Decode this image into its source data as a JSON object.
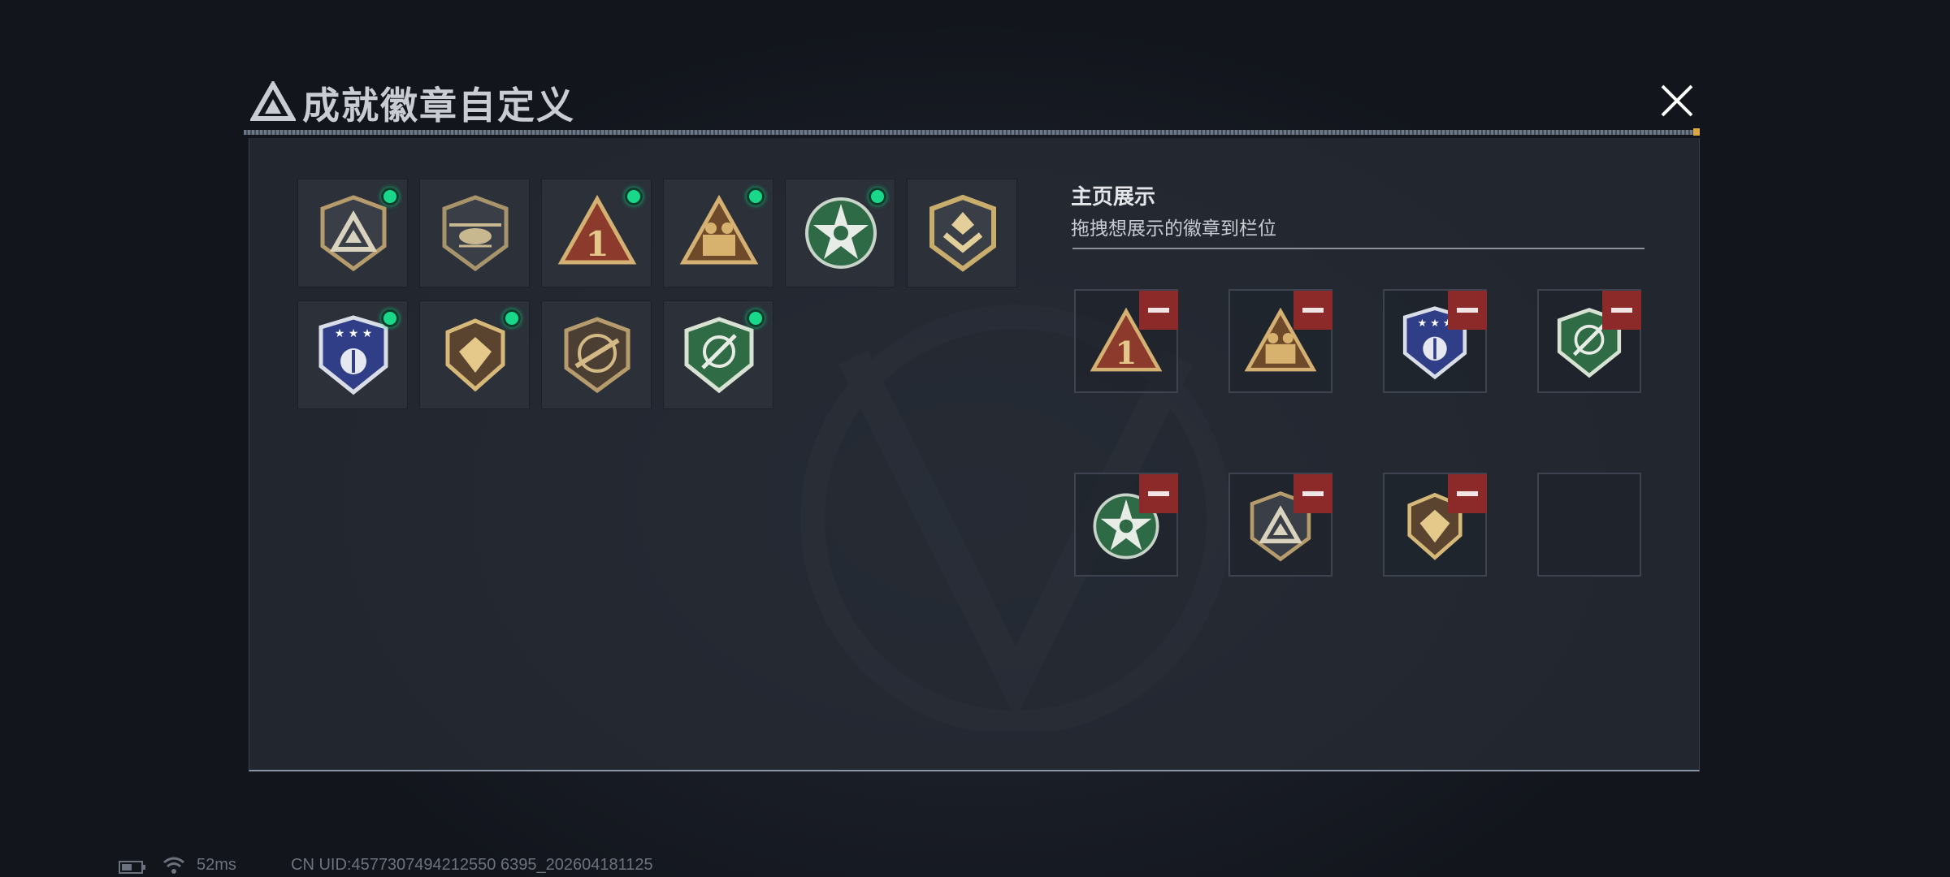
{
  "header": {
    "title": "成就徽章自定义",
    "logo_icon": "triangle-logo-icon",
    "close_icon": "close-x-icon"
  },
  "inventory": {
    "badges": [
      {
        "icon": "pyramid-shield-badge-icon",
        "equipped": true
      },
      {
        "icon": "helicopter-shield-badge-icon",
        "equipped": false
      },
      {
        "icon": "number-one-triangle-badge-icon",
        "equipped": true
      },
      {
        "icon": "soldiers-triangle-badge-icon",
        "equipped": true
      },
      {
        "icon": "star-skull-green-badge-icon",
        "equipped": true
      },
      {
        "icon": "chevron-shield-badge-icon",
        "equipped": false
      },
      {
        "icon": "blue-stars-shield-badge-icon",
        "equipped": true
      },
      {
        "icon": "gem-shield-badge-icon",
        "equipped": true
      },
      {
        "icon": "rifle-shield-badge-icon",
        "equipped": false
      },
      {
        "icon": "green-crosshair-shield-badge-icon",
        "equipped": true
      }
    ],
    "equipped_color": "#19d88a"
  },
  "showcase": {
    "title": "主页展示",
    "subtitle": "拖拽想展示的徽章到栏位",
    "slots": [
      {
        "icon": "number-one-triangle-badge-icon",
        "filled": true
      },
      {
        "icon": "soldiers-triangle-badge-icon",
        "filled": true
      },
      {
        "icon": "blue-stars-shield-badge-icon",
        "filled": true
      },
      {
        "icon": "green-crosshair-shield-badge-icon",
        "filled": true
      },
      {
        "icon": "star-skull-green-badge-icon",
        "filled": true
      },
      {
        "icon": "pyramid-shield-badge-icon",
        "filled": true
      },
      {
        "icon": "gem-shield-badge-icon",
        "filled": true
      },
      {
        "icon": "",
        "filled": false
      }
    ],
    "remove_icon": "minus-icon",
    "remove_color": "#8c2a2a"
  },
  "status_bar": {
    "ping": "52ms",
    "uid": "CN UID:4577307494212550 6395_202604181125"
  }
}
